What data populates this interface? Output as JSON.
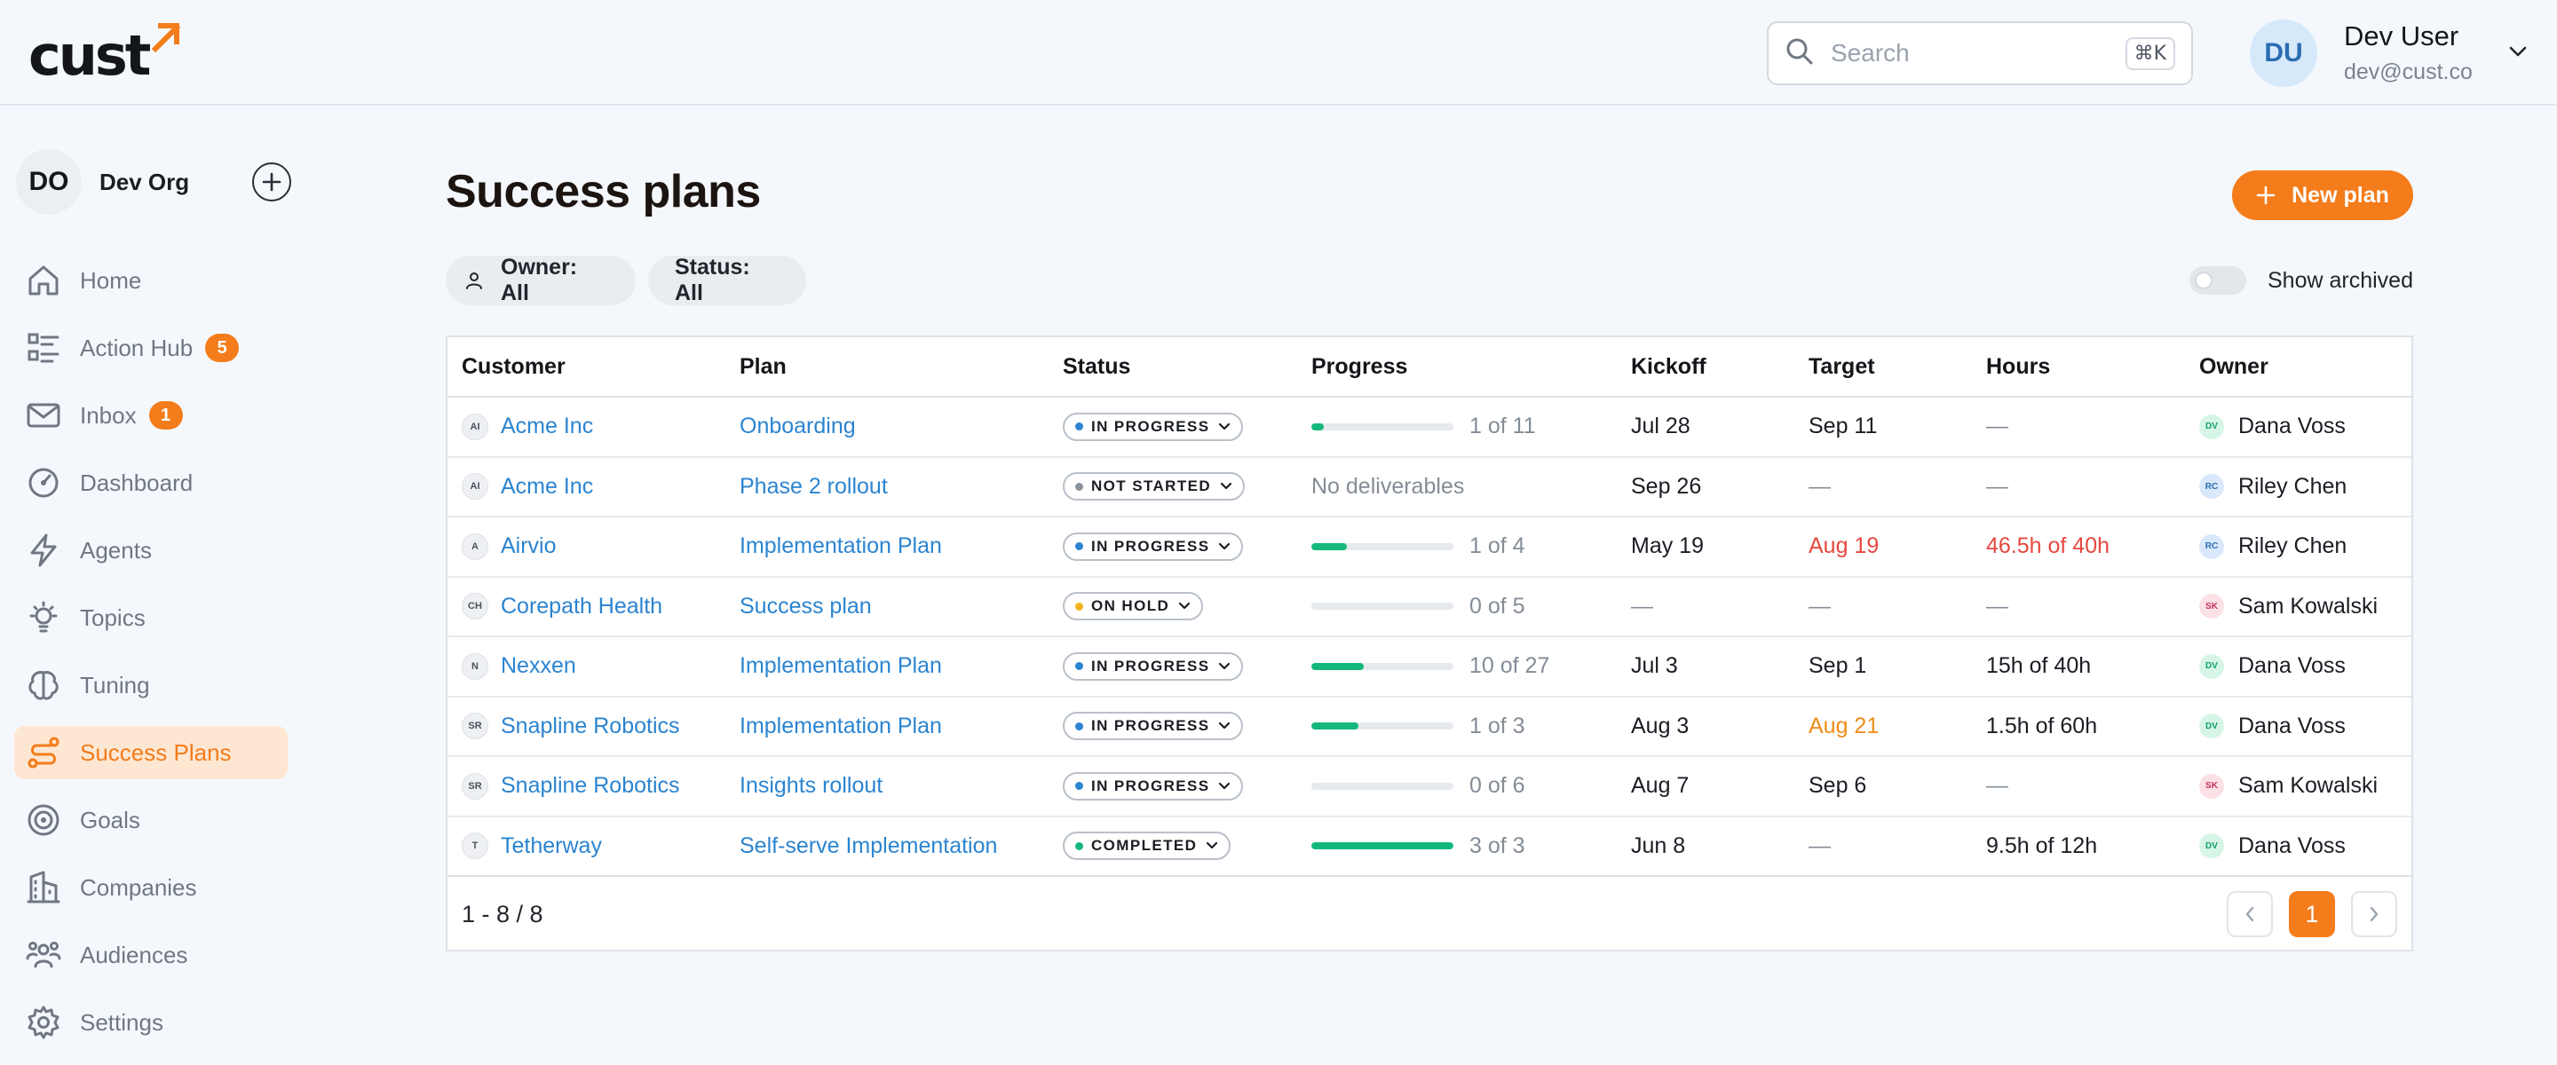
{
  "app": {
    "logo": "cust",
    "accent_color": "#f47c1b"
  },
  "header": {
    "search_placeholder": "Search",
    "search_shortcut": "⌘K",
    "user": {
      "initials": "DU",
      "name": "Dev User",
      "email": "dev@cust.co"
    }
  },
  "sidebar": {
    "org": {
      "initials": "DO",
      "name": "Dev Org"
    },
    "items": [
      {
        "label": "Home",
        "icon": "home-icon"
      },
      {
        "label": "Action Hub",
        "icon": "list-icon",
        "badge": "5"
      },
      {
        "label": "Inbox",
        "icon": "mail-icon",
        "badge": "1"
      },
      {
        "label": "Dashboard",
        "icon": "gauge-icon"
      },
      {
        "label": "Agents",
        "icon": "bolt-icon"
      },
      {
        "label": "Topics",
        "icon": "lightbulb-icon"
      },
      {
        "label": "Tuning",
        "icon": "brain-icon"
      },
      {
        "label": "Success Plans",
        "icon": "route-icon",
        "active": true
      },
      {
        "label": "Goals",
        "icon": "target-icon"
      },
      {
        "label": "Companies",
        "icon": "building-icon"
      },
      {
        "label": "Audiences",
        "icon": "users-icon"
      },
      {
        "label": "Settings",
        "icon": "gear-icon"
      }
    ]
  },
  "main": {
    "title": "Success plans",
    "new_plan_label": "New plan",
    "filters": {
      "owner": "Owner: All",
      "status": "Status: All"
    },
    "show_archived_label": "Show archived",
    "show_archived": false,
    "columns": [
      "Customer",
      "Plan",
      "Status",
      "Progress",
      "Kickoff",
      "Target",
      "Hours",
      "Owner"
    ],
    "rows": [
      {
        "cust_initials": "AI",
        "customer": "Acme Inc",
        "plan": "Onboarding",
        "status": "IN PROGRESS",
        "progress_text": "1 of 11",
        "progress": 0.09,
        "kickoff": "Jul 28",
        "target": "Sep 11",
        "target_tone": "normal",
        "hours": "—",
        "hours_tone": "muted",
        "owner_initials": "DV",
        "owner": "Dana Voss"
      },
      {
        "cust_initials": "AI",
        "customer": "Acme Inc",
        "plan": "Phase 2 rollout",
        "status": "NOT STARTED",
        "progress_text": "No deliverables",
        "progress": null,
        "kickoff": "Sep 26",
        "target": "—",
        "target_tone": "muted",
        "hours": "—",
        "hours_tone": "muted",
        "owner_initials": "RC",
        "owner": "Riley Chen"
      },
      {
        "cust_initials": "A",
        "customer": "Airvio",
        "plan": "Implementation Plan",
        "status": "IN PROGRESS",
        "progress_text": "1 of 4",
        "progress": 0.25,
        "kickoff": "May 19",
        "target": "Aug 19",
        "target_tone": "red",
        "hours": "46.5h of 40h",
        "hours_tone": "red",
        "owner_initials": "RC",
        "owner": "Riley Chen"
      },
      {
        "cust_initials": "CH",
        "customer": "Corepath Health",
        "plan": "Success plan",
        "status": "ON HOLD",
        "progress_text": "0 of 5",
        "progress": 0,
        "kickoff": "—",
        "target": "—",
        "target_tone": "muted",
        "hours": "—",
        "hours_tone": "muted",
        "owner_initials": "SK",
        "owner": "Sam Kowalski"
      },
      {
        "cust_initials": "N",
        "customer": "Nexxen",
        "plan": "Implementation Plan",
        "status": "IN PROGRESS",
        "progress_text": "10 of 27",
        "progress": 0.37,
        "kickoff": "Jul 3",
        "target": "Sep 1",
        "target_tone": "normal",
        "hours": "15h of 40h",
        "hours_tone": "normal",
        "owner_initials": "DV",
        "owner": "Dana Voss"
      },
      {
        "cust_initials": "SR",
        "customer": "Snapline Robotics",
        "plan": "Implementation Plan",
        "status": "IN PROGRESS",
        "progress_text": "1 of 3",
        "progress": 0.33,
        "kickoff": "Aug 3",
        "target": "Aug 21",
        "target_tone": "orange",
        "hours": "1.5h of 60h",
        "hours_tone": "normal",
        "owner_initials": "DV",
        "owner": "Dana Voss"
      },
      {
        "cust_initials": "SR",
        "customer": "Snapline Robotics",
        "plan": "Insights rollout",
        "status": "IN PROGRESS",
        "progress_text": "0 of 6",
        "progress": 0,
        "kickoff": "Aug 7",
        "target": "Sep 6",
        "target_tone": "normal",
        "hours": "—",
        "hours_tone": "muted",
        "owner_initials": "SK",
        "owner": "Sam Kowalski"
      },
      {
        "cust_initials": "T",
        "customer": "Tetherway",
        "plan": "Self-serve Implementation",
        "status": "COMPLETED",
        "progress_text": "3 of 3",
        "progress": 1,
        "kickoff": "Jun 8",
        "target": "—",
        "target_tone": "muted",
        "hours": "9.5h of 12h",
        "hours_tone": "normal",
        "owner_initials": "DV",
        "owner": "Dana Voss"
      }
    ],
    "status_colors": {
      "IN PROGRESS": "#2b84d0",
      "NOT STARTED": "#8a929c",
      "ON HOLD": "#f2b21b",
      "COMPLETED": "#15b87c"
    },
    "owner_colors": {
      "DV": {
        "bg": "#d6f5e7",
        "fg": "#13a06a"
      },
      "RC": {
        "bg": "#d9e9fb",
        "fg": "#2b6cb0"
      },
      "SK": {
        "bg": "#fbe0e6",
        "fg": "#c8345a"
      }
    },
    "pagination": {
      "range": "1 - 8 / 8",
      "current_page": "1"
    }
  }
}
